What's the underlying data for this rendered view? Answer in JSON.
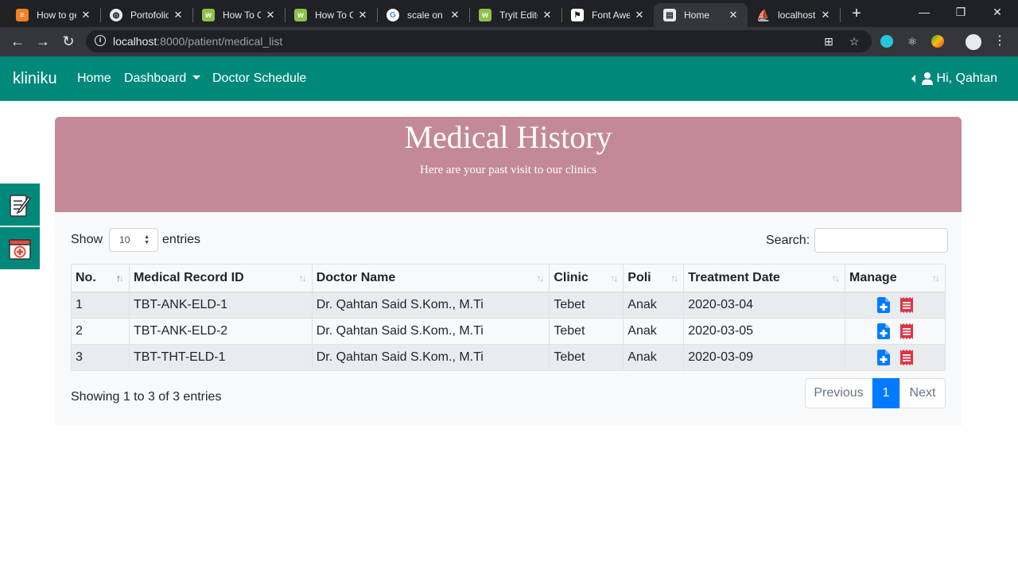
{
  "browser": {
    "tabs": [
      {
        "title": "How to ge",
        "icon": "stackoverflow-icon"
      },
      {
        "title": "Portofolio",
        "icon": "globe-icon"
      },
      {
        "title": "How To C",
        "icon": "w3schools-icon"
      },
      {
        "title": "How To C",
        "icon": "w3schools-icon"
      },
      {
        "title": "scale on h",
        "icon": "google-icon"
      },
      {
        "title": "Tryit Edito",
        "icon": "w3schools-icon"
      },
      {
        "title": "Font Awe",
        "icon": "flag-icon"
      },
      {
        "title": "Home",
        "icon": "page-icon",
        "active": true
      },
      {
        "title": "localhost",
        "icon": "phpmyadmin-icon"
      }
    ],
    "url_host": "localhost",
    "url_path": ":8000/patient/medical_list"
  },
  "navbar": {
    "brand": "kliniku",
    "links": [
      "Home",
      "Dashboard",
      "Doctor Schedule"
    ],
    "user": "Hi, Qahtan"
  },
  "jumbotron": {
    "title": "Medical History",
    "subtitle": "Here are your past visit to our clinics"
  },
  "table_controls": {
    "show_label": "Show",
    "entries_value": "10",
    "entries_label": "entries",
    "search_label": "Search:"
  },
  "table": {
    "headers": [
      "No.",
      "Medical Record ID",
      "Doctor Name",
      "Clinic",
      "Poli",
      "Treatment Date",
      "Manage"
    ],
    "rows": [
      {
        "no": "1",
        "record_id": "TBT-ANK-ELD-1",
        "doctor": "Dr. Qahtan Said S.Kom., M.Ti",
        "clinic": "Tebet",
        "poli": "Anak",
        "date": "2020-03-04"
      },
      {
        "no": "2",
        "record_id": "TBT-ANK-ELD-2",
        "doctor": "Dr. Qahtan Said S.Kom., M.Ti",
        "clinic": "Tebet",
        "poli": "Anak",
        "date": "2020-03-05"
      },
      {
        "no": "3",
        "record_id": "TBT-THT-ELD-1",
        "doctor": "Dr. Qahtan Said S.Kom., M.Ti",
        "clinic": "Tebet",
        "poli": "Anak",
        "date": "2020-03-09"
      }
    ]
  },
  "footer": {
    "info": "Showing 1 to 3 of 3 entries",
    "prev": "Previous",
    "page": "1",
    "next": "Next"
  },
  "colors": {
    "navbar": "#00897b",
    "jumbotron": "#c48996",
    "add_icon": "#007bff",
    "receipt_icon": "#dc3545",
    "page_active": "#007bff"
  }
}
